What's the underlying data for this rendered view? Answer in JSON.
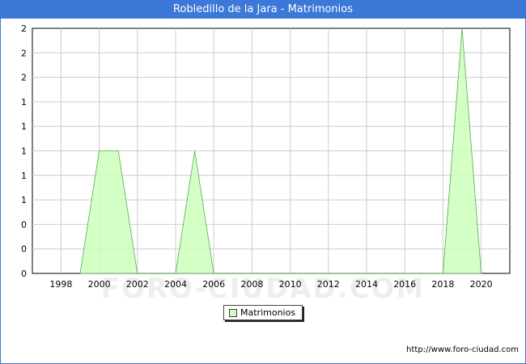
{
  "header": {
    "title": "Robledillo de la Jara - Matrimonios"
  },
  "chart_data": {
    "type": "area",
    "title": "Robledillo de la Jara - Matrimonios",
    "xlabel": "",
    "ylabel": "",
    "x_ticks": [
      "1998",
      "2000",
      "2002",
      "2004",
      "2006",
      "2008",
      "2010",
      "2012",
      "2014",
      "2016",
      "2018",
      "2020"
    ],
    "y_ticks": [
      "0",
      "0",
      "0",
      "1",
      "1",
      "1",
      "1",
      "1",
      "2",
      "2",
      "2"
    ],
    "x": [
      1999,
      2000,
      2001,
      2002,
      2003,
      2004,
      2005,
      2006,
      2007,
      2008,
      2009,
      2010,
      2011,
      2012,
      2013,
      2014,
      2015,
      2016,
      2017,
      2018,
      2019,
      2020
    ],
    "series": [
      {
        "name": "Matrimonios",
        "values": [
          0,
          1,
          1,
          0,
          0,
          0,
          1,
          0,
          0,
          0,
          0,
          0,
          0,
          0,
          0,
          0,
          0,
          0,
          0,
          0,
          2,
          0
        ]
      }
    ],
    "xlim": [
      1996.5,
      2021.5
    ],
    "ylim": [
      0,
      2
    ],
    "grid": true,
    "legend_position": "bottom-center",
    "colors": {
      "fill": "#ccffbb",
      "line": "#55aa55",
      "grid": "#cccccc",
      "axis": "#000000"
    },
    "watermark": "FORO-CIUDAD.COM"
  },
  "legend": {
    "label": "Matrimonios"
  },
  "footer": {
    "source": "http://www.foro-ciudad.com"
  }
}
